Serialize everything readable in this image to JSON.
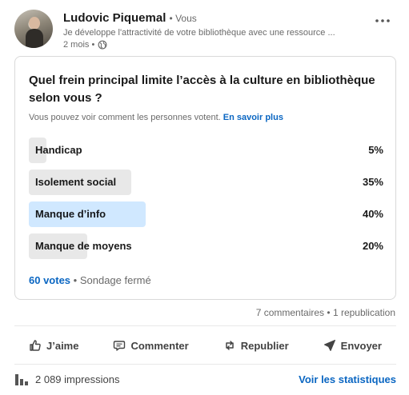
{
  "post": {
    "author_name": "Ludovic Piquemal",
    "author_relation": "• Vous",
    "headline": "Je développe l'attractivité de votre bibliothèque avec une ressource ...",
    "time": "2 mois •",
    "visibility_icon": "globe-icon",
    "more_icon": "ellipsis-icon"
  },
  "poll": {
    "question": "Quel frein principal limite l’accès à la culture en bibliothèque selon vous ?",
    "visibility_text": "Vous pouvez voir comment les personnes votent.",
    "learn_more": "En savoir plus",
    "options": [
      {
        "label": "Handicap",
        "percent": 5,
        "percent_label": "5%",
        "selected": false
      },
      {
        "label": "Isolement social",
        "percent": 35,
        "percent_label": "35%",
        "selected": false
      },
      {
        "label": "Manque d’info",
        "percent": 40,
        "percent_label": "40%",
        "selected": true
      },
      {
        "label": "Manque de moyens",
        "percent": 20,
        "percent_label": "20%",
        "selected": false
      }
    ],
    "votes": "60 votes",
    "status": "• Sondage fermé"
  },
  "social": {
    "comments": "7 commentaires",
    "separator": " • ",
    "reposts": "1 republication"
  },
  "actions": {
    "like": "J’aime",
    "comment": "Commenter",
    "repost": "Republier",
    "send": "Envoyer"
  },
  "stats": {
    "impressions": "2 089 impressions",
    "view_stats": "Voir les statistiques"
  },
  "colors": {
    "link": "#0a66c2",
    "bar": "#e8e8e8",
    "bar_selected": "#d0e8ff"
  }
}
